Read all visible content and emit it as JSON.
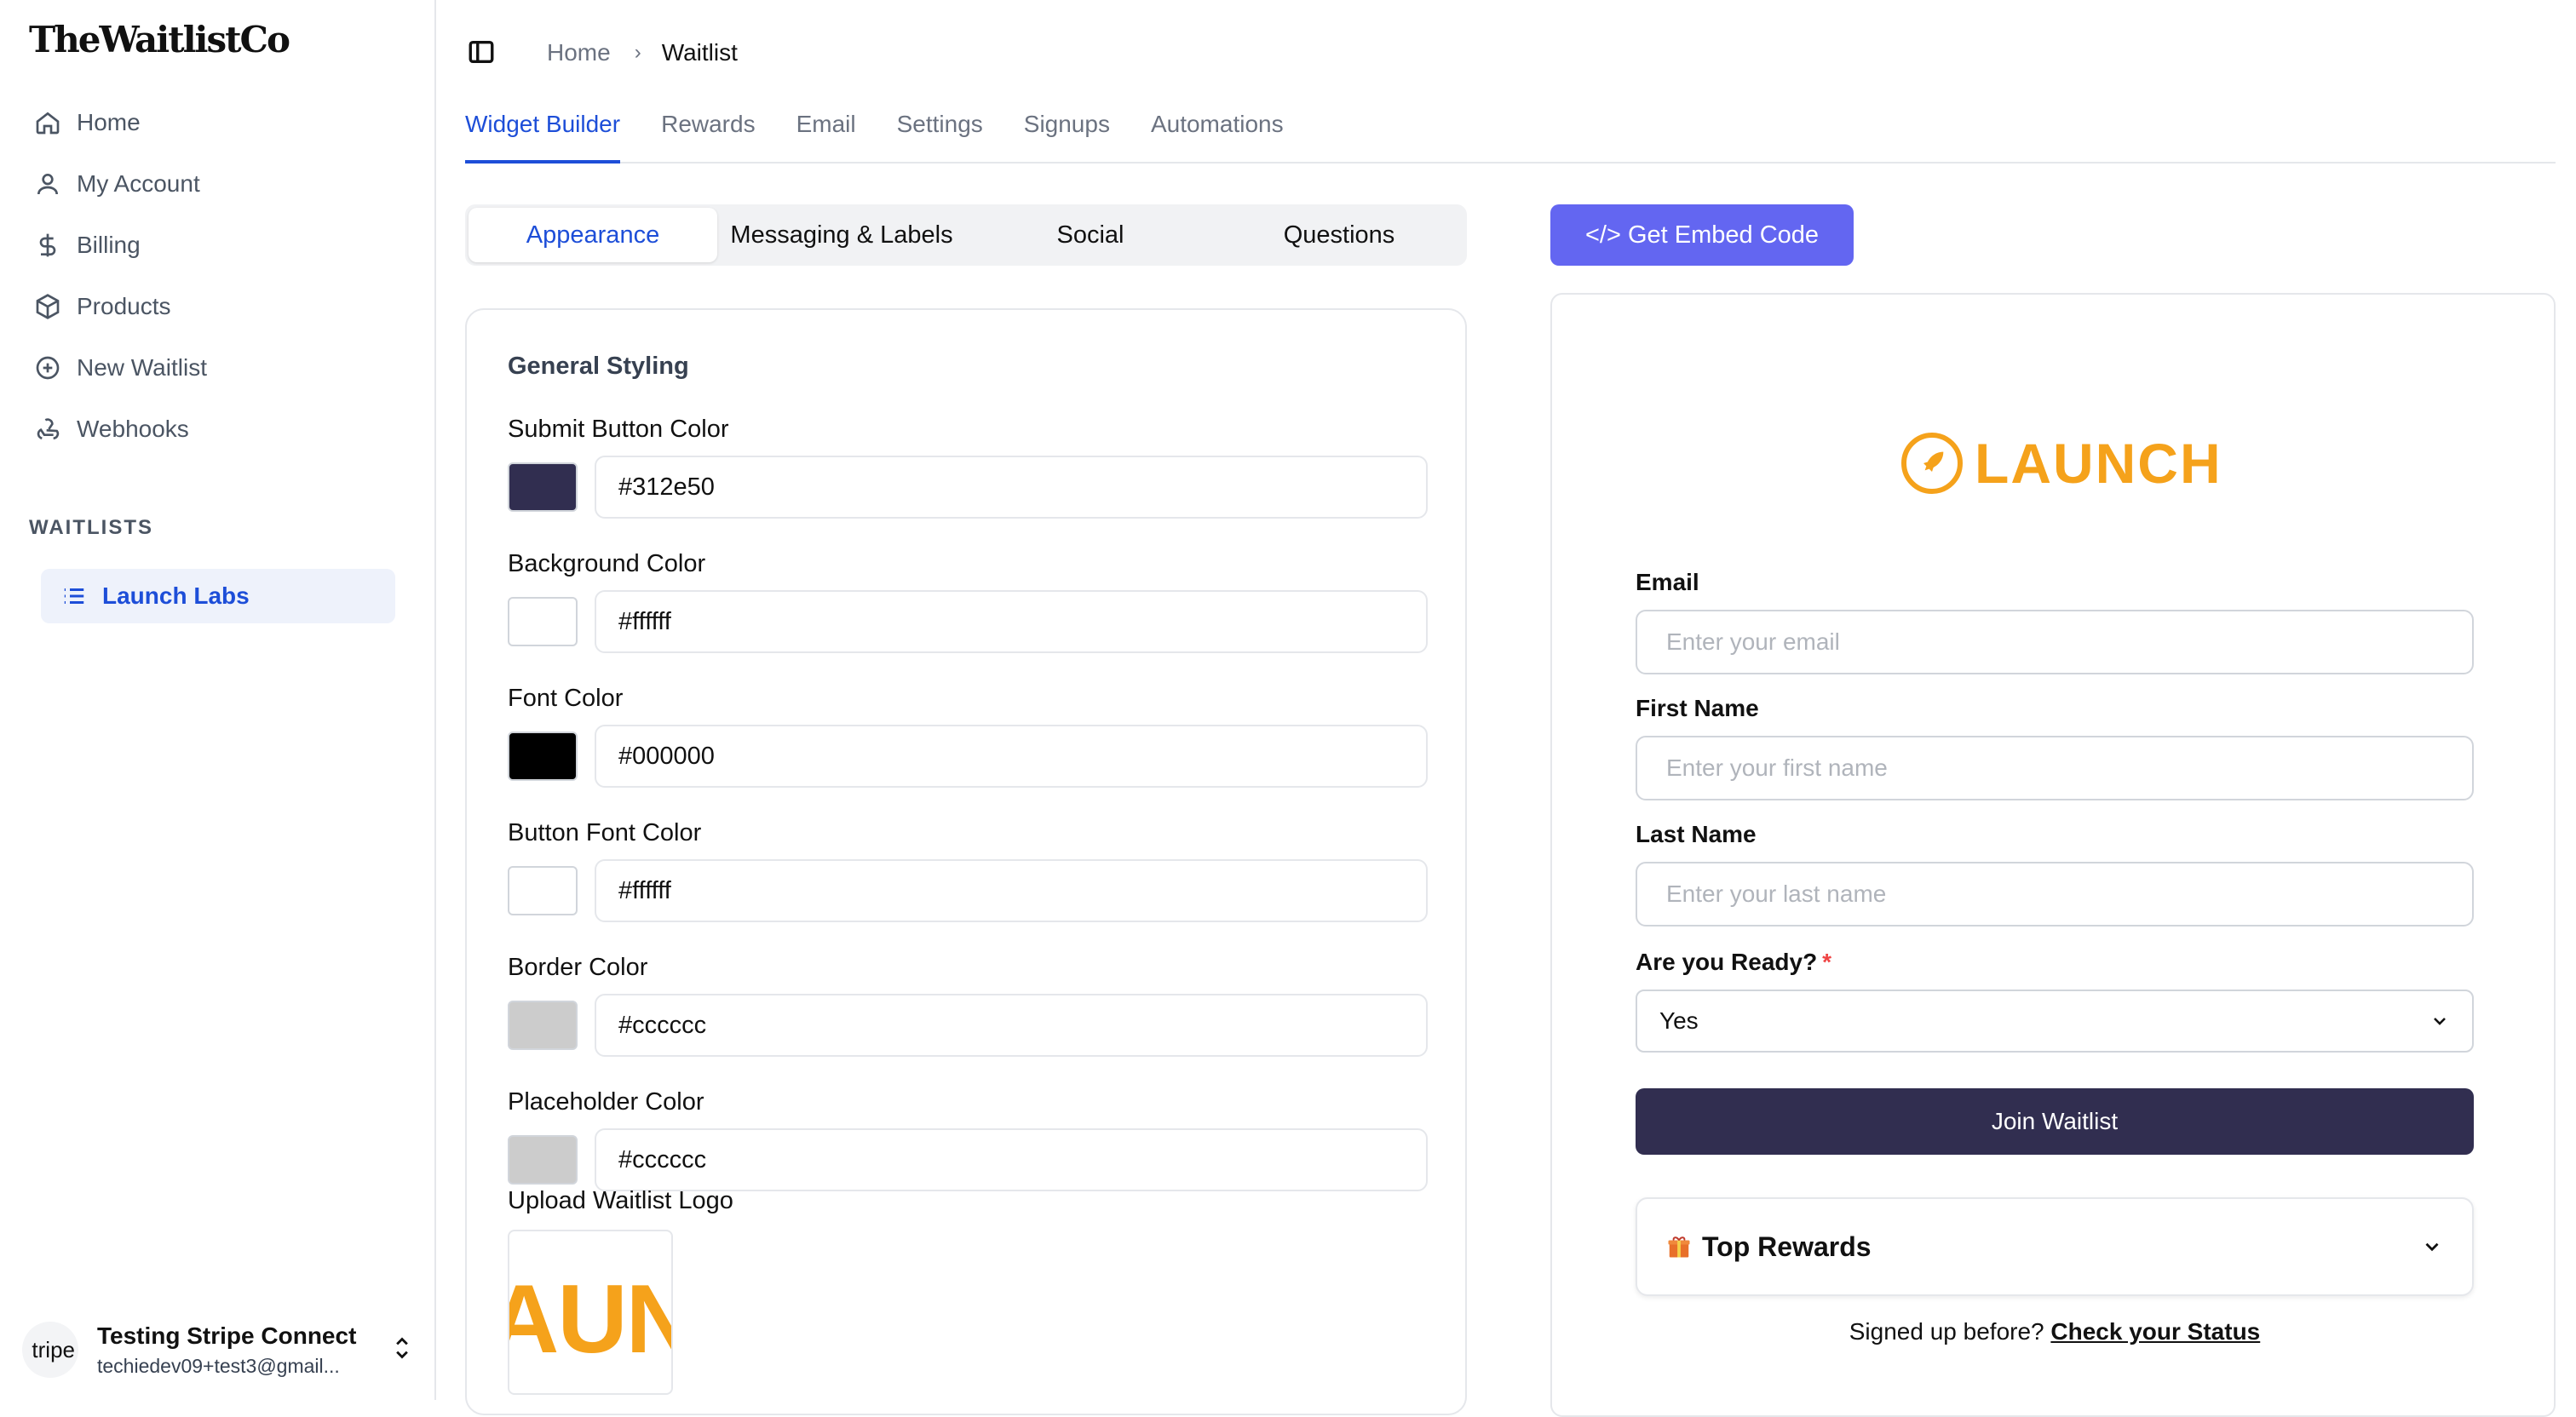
{
  "brand": "TheWaitlistCo",
  "sidebar": {
    "nav": [
      {
        "label": "Home",
        "icon": "home-icon"
      },
      {
        "label": "My Account",
        "icon": "user-icon"
      },
      {
        "label": "Billing",
        "icon": "dollar-icon"
      },
      {
        "label": "Products",
        "icon": "box-icon"
      },
      {
        "label": "New Waitlist",
        "icon": "plus-circle-icon"
      },
      {
        "label": "Webhooks",
        "icon": "webhook-icon"
      }
    ],
    "section_label": "WAITLISTS",
    "waitlists": [
      {
        "label": "Launch Labs",
        "icon": "list-icon"
      }
    ],
    "account": {
      "avatar_text": "tripe",
      "name": "Testing Stripe Connect",
      "email": "techiedev09+test3@gmail..."
    }
  },
  "breadcrumb": {
    "home": "Home",
    "current": "Waitlist"
  },
  "tabs": [
    "Widget Builder",
    "Rewards",
    "Email",
    "Settings",
    "Signups",
    "Automations"
  ],
  "active_tab": "Widget Builder",
  "segments": [
    "Appearance",
    "Messaging & Labels",
    "Social",
    "Questions"
  ],
  "active_segment": "Appearance",
  "styling": {
    "title": "General Styling",
    "fields": [
      {
        "label": "Submit Button Color",
        "value": "#312e50",
        "swatch": "#312e50"
      },
      {
        "label": "Background Color",
        "value": "#ffffff",
        "swatch": "#ffffff"
      },
      {
        "label": "Font Color",
        "value": "#000000",
        "swatch": "#000000"
      },
      {
        "label": "Button Font Color",
        "value": "#ffffff",
        "swatch": "#ffffff"
      },
      {
        "label": "Border Color",
        "value": "#cccccc",
        "swatch": "#cccccc"
      },
      {
        "label": "Placeholder Color",
        "value": "#cccccc",
        "swatch": "#cccccc"
      }
    ],
    "logo_label": "Upload Waitlist Logo",
    "logo_text": "AUN"
  },
  "embed_button": "</> Get Embed Code",
  "preview": {
    "logo_text": "LAUNCH",
    "email_label": "Email",
    "email_placeholder": "Enter your email",
    "first_label": "First Name",
    "first_placeholder": "Enter your first name",
    "last_label": "Last Name",
    "last_placeholder": "Enter your last name",
    "ready_label": "Are you Ready?",
    "required_mark": "*",
    "ready_value": "Yes",
    "join_button": "Join Waitlist",
    "rewards_label": "Top Rewards",
    "signed_text": "Signed up before?",
    "status_link": "Check your Status"
  },
  "colors": {
    "accent": "#1d4ed8",
    "embed": "#6366f1",
    "submit": "#312e50",
    "logo": "#f5a21b"
  }
}
